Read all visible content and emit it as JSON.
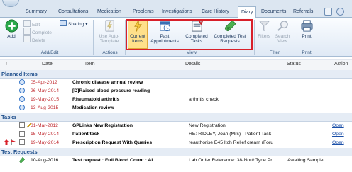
{
  "tabs": {
    "items": [
      "Summary",
      "Consultations",
      "Medication",
      "Problems",
      "Investigations",
      "Care History",
      "Diary",
      "Documents",
      "Referrals"
    ],
    "active": "Diary"
  },
  "ribbon": {
    "add_edit": {
      "add_label": "Add",
      "edit_label": "Edit",
      "complete_label": "Complete",
      "delete_label": "Delete",
      "sharing_label": "Sharing",
      "group_label": "Add/Edit"
    },
    "actions": {
      "use_auto_template_label": "Use Auto-Template",
      "group_label": "Actions"
    },
    "view": {
      "current_items_label": "Current Items",
      "past_appointments_label": "Past Appointments",
      "completed_tasks_label": "Completed Tasks",
      "completed_test_requests_label": "Completed Test Requests",
      "group_label": "View"
    },
    "filter": {
      "filters_label": "Filters",
      "search_view_label": "Search View",
      "group_label": "Filter"
    },
    "print": {
      "print_label": "Print",
      "group_label": "Print"
    }
  },
  "columns": {
    "bang": "!",
    "date": "Date",
    "item": "Item",
    "details": "Details",
    "status": "Status",
    "action": "Action"
  },
  "sections": {
    "planned": {
      "title": "Planned Items",
      "rows": [
        {
          "date": "05-Apr-2012",
          "item": "Chronic disease annual review",
          "details": ""
        },
        {
          "date": "26-May-2014",
          "item": "[D]Raised blood pressure reading",
          "details": ""
        },
        {
          "date": "19-May-2015",
          "item": "Rheumatoid arthritis",
          "details": "arthritis check"
        },
        {
          "date": "13-Aug-2015",
          "item": "Medication review",
          "details": ""
        }
      ]
    },
    "tasks": {
      "title": "Tasks",
      "rows": [
        {
          "date": "31-Mar-2012",
          "item": "GPLinks New Registration",
          "details": "New Registration",
          "action": "Open"
        },
        {
          "date": "15-May-2014",
          "item": "Patient task",
          "details": "RE: RIDLEY, Joan (Mrs) - Patient Task",
          "action": "Open"
        },
        {
          "date": "19-May-2014",
          "item": "Prescription Request With Queries",
          "details": "reauthorise E45 Itch Relief cream (Foru",
          "action": "Open"
        }
      ]
    },
    "tests": {
      "title": "Test Requests",
      "rows": [
        {
          "date": "10-Aug-2016",
          "item": "Test request : Full Blood Count : Al",
          "details": "Lab Order Reference: 38-NorthTyne Pr",
          "status": "Awaiting Sample"
        }
      ]
    }
  },
  "colors": {
    "highlight": "#d8202a",
    "date_red": "#c0282e",
    "section_blue": "#1f4f8c"
  }
}
